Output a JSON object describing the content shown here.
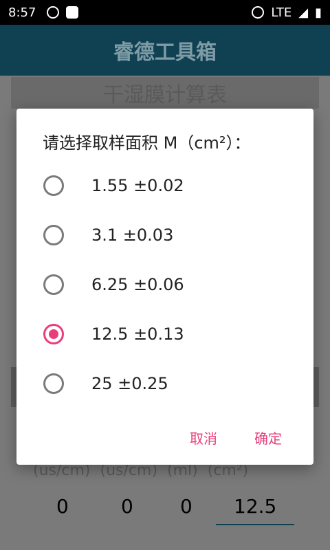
{
  "status_bar": {
    "time": "8:57",
    "network": "LTE"
  },
  "app_bar": {
    "title": "睿德工具箱"
  },
  "background": {
    "sheet_title": "干湿膜计算表",
    "units": [
      "(us/cm)",
      "(us/cm)",
      "(ml)",
      "(cm²)"
    ],
    "values": [
      "0",
      "0",
      "0",
      "12.5"
    ]
  },
  "dialog": {
    "title": "请选择取样面积 M（cm²）：",
    "options": [
      {
        "label": "1.55 ±0.02",
        "selected": false
      },
      {
        "label": "3.1 ±0.03",
        "selected": false
      },
      {
        "label": "6.25 ±0.06",
        "selected": false
      },
      {
        "label": "12.5 ±0.13",
        "selected": true
      },
      {
        "label": "25 ±0.25",
        "selected": false
      }
    ],
    "cancel_label": "取消",
    "ok_label": "确定"
  },
  "colors": {
    "accent": "#e83e7a",
    "app_bar": "#0f4152"
  }
}
